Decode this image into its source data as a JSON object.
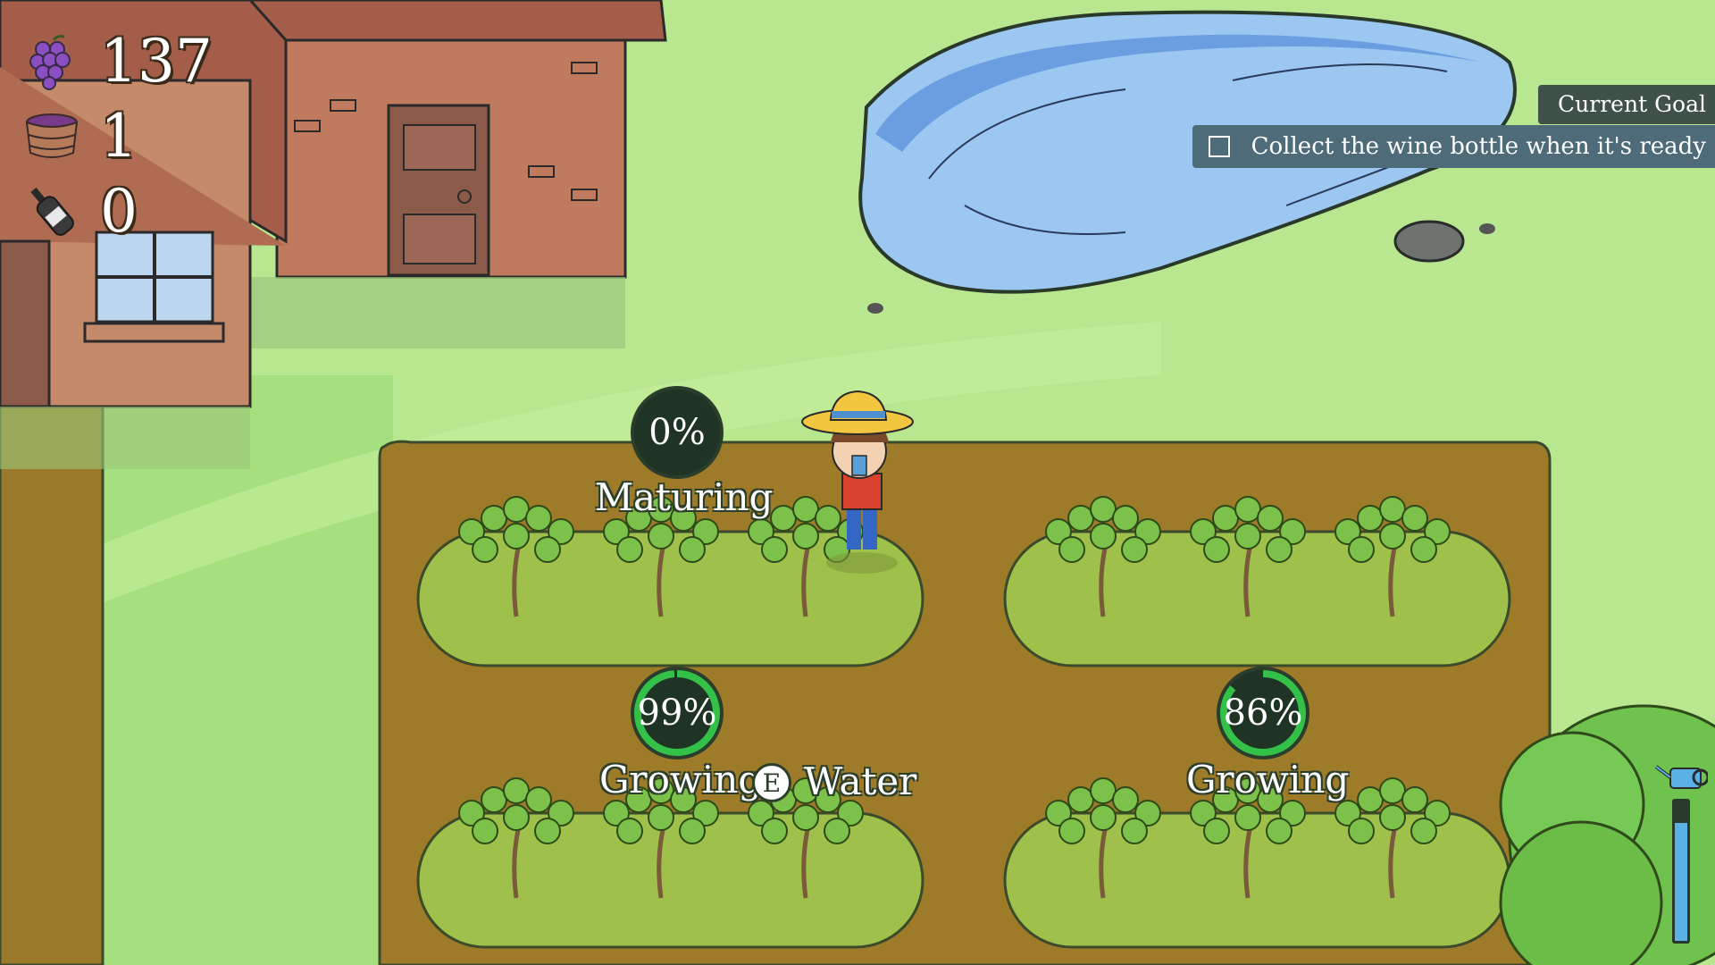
{
  "hud": {
    "grapes": {
      "icon": "grape-icon",
      "value": "137"
    },
    "juice": {
      "icon": "barrel-icon",
      "value": "1"
    },
    "wine": {
      "icon": "wine-bottle-icon",
      "value": "0"
    }
  },
  "goal": {
    "title": "Current Goal",
    "task": "Collect the wine bottle when it's ready",
    "checked": false
  },
  "plots": [
    {
      "percent_text": "0%",
      "progress": 0.0,
      "status": "Maturing"
    },
    {
      "percent_text": "99%",
      "progress": 0.99,
      "status": "Growing"
    },
    {
      "percent_text": "86%",
      "progress": 0.86,
      "status": "Growing"
    }
  ],
  "prompt": {
    "key": "E",
    "action": "Water"
  },
  "water_meter": {
    "icon": "watering-can-icon",
    "level": 0.85
  },
  "colors": {
    "progress": "#33c14a",
    "ring_bg": "#1f3424",
    "water": "#5bb0e6"
  }
}
